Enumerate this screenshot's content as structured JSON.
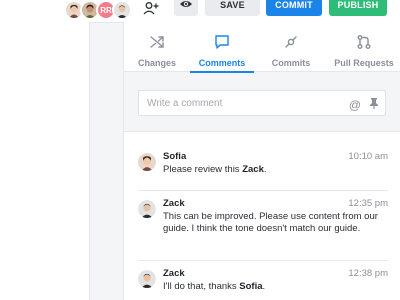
{
  "toolbar": {
    "avatars": [
      {
        "name": "avatar-woman-1",
        "initials": ""
      },
      {
        "name": "avatar-woman-2",
        "initials": ""
      },
      {
        "name": "avatar-rr",
        "initials": "RR"
      },
      {
        "name": "avatar-man",
        "initials": ""
      }
    ],
    "save_label": "SAVE",
    "commit_label": "COMMIT",
    "publish_label": "PUBLISH",
    "colors": {
      "commit": "#1a84e8",
      "publish": "#2ebc79",
      "save": "#e9ebee"
    }
  },
  "panel": {
    "tabs": [
      {
        "label": "Changes",
        "icon": "shuffle-icon",
        "active": false
      },
      {
        "label": "Comments",
        "icon": "comment-icon",
        "active": true
      },
      {
        "label": "Commits",
        "icon": "commit-icon",
        "active": false
      },
      {
        "label": "Pull Requests",
        "icon": "pull-request-icon",
        "active": false
      }
    ],
    "compose": {
      "placeholder": "Write a comment",
      "mention_symbol": "@",
      "pin_icon": "pin-icon"
    },
    "comments": [
      {
        "author": "Sofia",
        "time": "10:10 am",
        "text_parts": [
          "Please review this ",
          "Zack",
          "."
        ]
      },
      {
        "author": "Zack",
        "time": "12:35 pm",
        "text_parts": [
          "This can be improved. Please use content from our guide. I think the tone doesn't match our guide."
        ]
      },
      {
        "author": "Zack",
        "time": "12:38 pm",
        "text_parts": [
          "I'll do that, thanks ",
          "Sofia",
          "."
        ]
      }
    ]
  }
}
